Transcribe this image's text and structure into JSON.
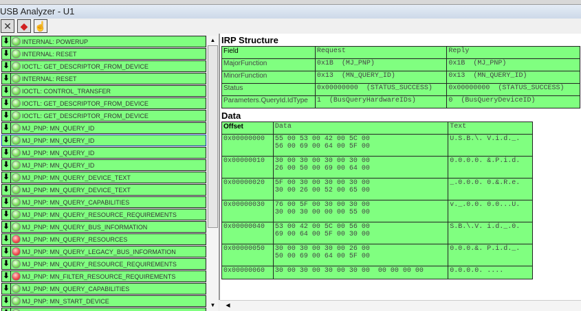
{
  "window": {
    "title": "USB Analyzer - U1"
  },
  "toolbar": [
    {
      "icon": "close-icon",
      "glyph": "✕"
    },
    {
      "icon": "stop-icon",
      "glyph": "◆"
    },
    {
      "icon": "hand-icon",
      "glyph": "☝"
    }
  ],
  "events": [
    {
      "label": "INTERNAL:  POWERUP",
      "status": "green"
    },
    {
      "label": "INTERNAL:  RESET",
      "status": "green"
    },
    {
      "label": "IOCTL:  GET_DESCRIPTOR_FROM_DEVICE",
      "status": "green"
    },
    {
      "label": "INTERNAL:  RESET",
      "status": "green"
    },
    {
      "label": "IOCTL:  CONTROL_TRANSFER",
      "status": "green"
    },
    {
      "label": "IOCTL:  GET_DESCRIPTOR_FROM_DEVICE",
      "status": "green"
    },
    {
      "label": "IOCTL:  GET_DESCRIPTOR_FROM_DEVICE",
      "status": "green"
    },
    {
      "label": "MJ_PNP:  MN_QUERY_ID",
      "status": "green"
    },
    {
      "label": "MJ_PNP:  MN_QUERY_ID",
      "status": "green",
      "selected": true
    },
    {
      "label": "MJ_PNP:  MN_QUERY_ID",
      "status": "green"
    },
    {
      "label": "MJ_PNP:  MN_QUERY_ID",
      "status": "green"
    },
    {
      "label": "MJ_PNP:  MN_QUERY_DEVICE_TEXT",
      "status": "green"
    },
    {
      "label": "MJ_PNP:  MN_QUERY_DEVICE_TEXT",
      "status": "green"
    },
    {
      "label": "MJ_PNP:  MN_QUERY_CAPABILITIES",
      "status": "green"
    },
    {
      "label": "MJ_PNP:  MN_QUERY_RESOURCE_REQUIREMENTS",
      "status": "green"
    },
    {
      "label": "MJ_PNP:  MN_QUERY_BUS_INFORMATION",
      "status": "green"
    },
    {
      "label": "MJ_PNP:  MN_QUERY_RESOURCES",
      "status": "red"
    },
    {
      "label": "MJ_PNP:  MN_QUERY_LEGACY_BUS_INFORMATION",
      "status": "red"
    },
    {
      "label": "MJ_PNP:  MN_QUERY_RESOURCE_REQUIREMENTS",
      "status": "green"
    },
    {
      "label": "MJ_PNP:  MN_FILTER_RESOURCE_REQUIREMENTS",
      "status": "red"
    },
    {
      "label": "MJ_PNP:  MN_QUERY_CAPABILITIES",
      "status": "green"
    },
    {
      "label": "MJ_PNP:  MN_START_DEVICE",
      "status": "green"
    },
    {
      "label": "",
      "status": "green"
    }
  ],
  "irp": {
    "title": "IRP Structure",
    "headers": [
      "Field",
      "Request",
      "Reply"
    ],
    "rows": [
      [
        "MajorFunction",
        "0x1B  (MJ_PNP)",
        "0x1B  (MJ_PNP)"
      ],
      [
        "MinorFunction",
        "0x13  (MN_QUERY_ID)",
        "0x13  (MN_QUERY_ID)"
      ],
      [
        "Status",
        "0x00000000  (STATUS_SUCCESS)",
        "0x00000000  (STATUS_SUCCESS)"
      ],
      [
        "Parameters.QueryId.IdType",
        "1  (BusQueryHardwareIDs)",
        "0  (BusQueryDeviceID)"
      ]
    ]
  },
  "data": {
    "title": "Data",
    "headers": [
      "Offset",
      "Data",
      "Text"
    ],
    "rows": [
      [
        "0x00000000",
        "55 00 53 00 42 00 5C 00\n56 00 69 00 64 00 5F 00",
        "U.S.B.\\. V.i.d._."
      ],
      [
        "0x00000010",
        "30 00 30 00 30 00 30 00\n26 00 50 00 69 00 64 00",
        "0.0.0.0. &.P.i.d."
      ],
      [
        "0x00000020",
        "5F 00 30 00 30 00 30 00\n30 00 26 00 52 00 65 00",
        "_.0.0.0. 0.&.R.e."
      ],
      [
        "0x00000030",
        "76 00 5F 00 30 00 30 00\n30 00 30 00 00 00 55 00",
        "v._.0.0. 0.0...U."
      ],
      [
        "0x00000040",
        "53 00 42 00 5C 00 56 00\n69 00 64 00 5F 00 30 00",
        "S.B.\\.V. i.d._.0."
      ],
      [
        "0x00000050",
        "30 00 30 00 30 00 26 00\n50 00 69 00 64 00 5F 00",
        "0.0.0.&. P.i.d._."
      ],
      [
        "0x00000060",
        "30 00 30 00 30 00 30 00  00 00 00 00",
        "0.0.0.0. ...."
      ]
    ]
  }
}
